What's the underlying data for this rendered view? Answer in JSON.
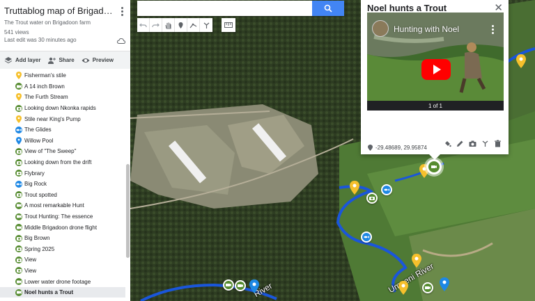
{
  "sidebar": {
    "title": "Truttablog map of Brigadoon on t...",
    "subtitle": "The Trout water on Brigadoon farm",
    "views": "541 views",
    "last_edit": "Last edit was 30 minutes ago",
    "actions": {
      "add_layer": "Add layer",
      "share": "Share",
      "preview": "Preview"
    },
    "items": [
      {
        "label": "Fisherman's stile",
        "icon": "yellow-pin-icon",
        "color": "#f6c02c"
      },
      {
        "label": "A 14 inch Brown",
        "icon": "video-icon",
        "color": "#558b2f"
      },
      {
        "label": "The Furth Stream",
        "icon": "yellow-pin-icon",
        "color": "#f6c02c"
      },
      {
        "label": "Looking down Nkonka rapids",
        "icon": "camera-icon",
        "color": "#558b2f"
      },
      {
        "label": "Stile near King's Pump",
        "icon": "yellow-pin-icon",
        "color": "#f6c02c"
      },
      {
        "label": "The Glides",
        "icon": "fish-icon",
        "color": "#1e88e5"
      },
      {
        "label": "Willow Pool",
        "icon": "blue-pin-icon",
        "color": "#1e88e5"
      },
      {
        "label": "View of \"The Sweep\"",
        "icon": "camera-icon",
        "color": "#558b2f"
      },
      {
        "label": "Looking down from the drift",
        "icon": "camera-icon",
        "color": "#558b2f"
      },
      {
        "label": "Flybrary",
        "icon": "camera-icon",
        "color": "#558b2f"
      },
      {
        "label": "Big Rock",
        "icon": "fish-icon",
        "color": "#1e88e5"
      },
      {
        "label": "Trout spotted",
        "icon": "camera-icon",
        "color": "#558b2f"
      },
      {
        "label": "A most remarkable Hunt",
        "icon": "video-icon",
        "color": "#558b2f"
      },
      {
        "label": "Trout Hunting: The essence",
        "icon": "video-icon",
        "color": "#558b2f"
      },
      {
        "label": "Middle Brigadoon drone flight",
        "icon": "video-icon",
        "color": "#558b2f"
      },
      {
        "label": "Big Brown",
        "icon": "camera-icon",
        "color": "#558b2f"
      },
      {
        "label": "Spring 2025",
        "icon": "camera-icon",
        "color": "#558b2f"
      },
      {
        "label": "View",
        "icon": "camera-icon",
        "color": "#558b2f"
      },
      {
        "label": "View",
        "icon": "camera-icon",
        "color": "#558b2f"
      },
      {
        "label": "Lower water drone footage",
        "icon": "video-icon",
        "color": "#558b2f"
      },
      {
        "label": "Noel hunts a Trout",
        "icon": "video-icon",
        "color": "#558b2f",
        "selected": true
      }
    ]
  },
  "search": {
    "placeholder": "",
    "value": ""
  },
  "popup": {
    "title": "Noel hunts a Trout",
    "video_title": "Hunting with Noel",
    "pager": "1 of 1",
    "coords": "-29.48689, 29.95874"
  },
  "map": {
    "river_label": "Umgeni River",
    "river_label_left": "River"
  },
  "colors": {
    "accent": "#4285f4",
    "river": "#1a56db",
    "yellow_pin": "#f6c02c",
    "green_marker": "#558b2f",
    "blue_marker": "#1e88e5"
  }
}
